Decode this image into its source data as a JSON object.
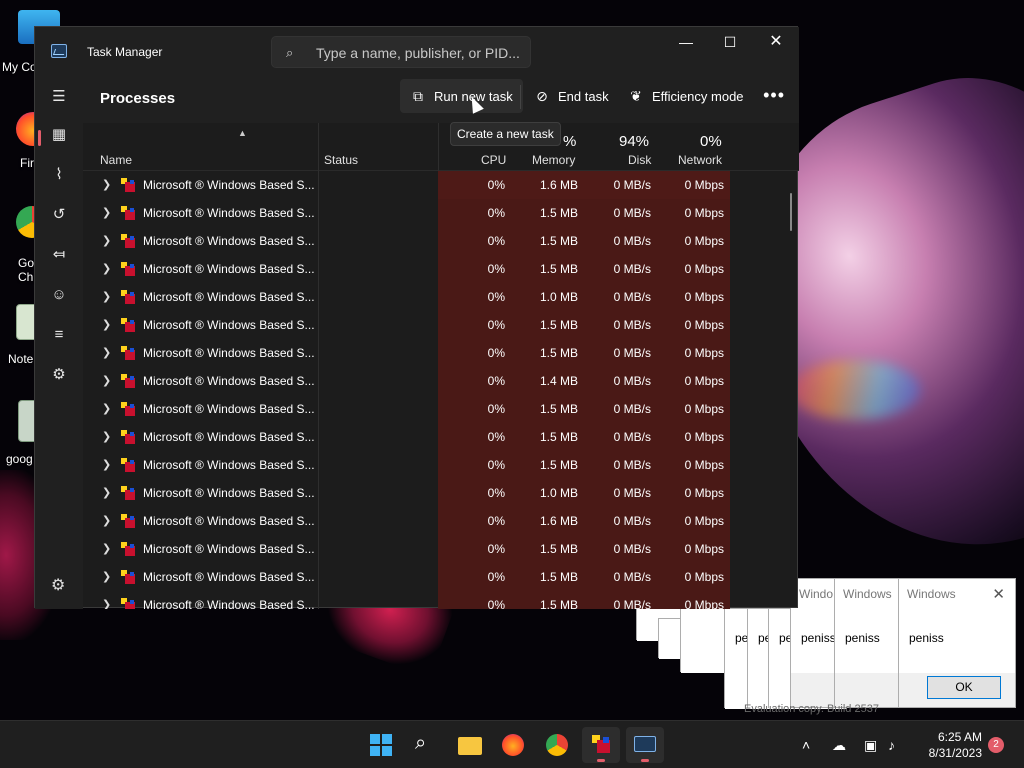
{
  "desktop": {
    "icons": [
      {
        "label": "My Co"
      },
      {
        "label": "Fir"
      },
      {
        "label": "Go\nChr"
      },
      {
        "label": "Note"
      },
      {
        "label": "goog"
      }
    ],
    "watermark": "Evaluation copy. Build 2537"
  },
  "task_manager": {
    "title": "Task Manager",
    "search_placeholder": "Type a name, publisher, or PID...",
    "heading": "Processes",
    "toolbar": {
      "run_new_task": "Run new task",
      "end_task": "End task",
      "efficiency_mode": "Efficiency mode",
      "more": "•••"
    },
    "tooltip": "Create a new task",
    "columns": {
      "name": "Name",
      "status": "Status",
      "cpu_pct": "%",
      "cpu": "CPU",
      "memory": "Memory",
      "disk_pct": "94%",
      "disk": "Disk",
      "network_pct": "0%",
      "network": "Network"
    },
    "rows": [
      {
        "name": "Microsoft ® Windows Based S...",
        "cpu": "0%",
        "memory": "1.6 MB",
        "disk": "0 MB/s",
        "network": "0 Mbps"
      },
      {
        "name": "Microsoft ® Windows Based S...",
        "cpu": "0%",
        "memory": "1.5 MB",
        "disk": "0 MB/s",
        "network": "0 Mbps"
      },
      {
        "name": "Microsoft ® Windows Based S...",
        "cpu": "0%",
        "memory": "1.5 MB",
        "disk": "0 MB/s",
        "network": "0 Mbps"
      },
      {
        "name": "Microsoft ® Windows Based S...",
        "cpu": "0%",
        "memory": "1.5 MB",
        "disk": "0 MB/s",
        "network": "0 Mbps"
      },
      {
        "name": "Microsoft ® Windows Based S...",
        "cpu": "0%",
        "memory": "1.0 MB",
        "disk": "0 MB/s",
        "network": "0 Mbps"
      },
      {
        "name": "Microsoft ® Windows Based S...",
        "cpu": "0%",
        "memory": "1.5 MB",
        "disk": "0 MB/s",
        "network": "0 Mbps"
      },
      {
        "name": "Microsoft ® Windows Based S...",
        "cpu": "0%",
        "memory": "1.5 MB",
        "disk": "0 MB/s",
        "network": "0 Mbps"
      },
      {
        "name": "Microsoft ® Windows Based S...",
        "cpu": "0%",
        "memory": "1.4 MB",
        "disk": "0 MB/s",
        "network": "0 Mbps"
      },
      {
        "name": "Microsoft ® Windows Based S...",
        "cpu": "0%",
        "memory": "1.5 MB",
        "disk": "0 MB/s",
        "network": "0 Mbps"
      },
      {
        "name": "Microsoft ® Windows Based S...",
        "cpu": "0%",
        "memory": "1.5 MB",
        "disk": "0 MB/s",
        "network": "0 Mbps"
      },
      {
        "name": "Microsoft ® Windows Based S...",
        "cpu": "0%",
        "memory": "1.5 MB",
        "disk": "0 MB/s",
        "network": "0 Mbps"
      },
      {
        "name": "Microsoft ® Windows Based S...",
        "cpu": "0%",
        "memory": "1.0 MB",
        "disk": "0 MB/s",
        "network": "0 Mbps"
      },
      {
        "name": "Microsoft ® Windows Based S...",
        "cpu": "0%",
        "memory": "1.6 MB",
        "disk": "0 MB/s",
        "network": "0 Mbps"
      },
      {
        "name": "Microsoft ® Windows Based S...",
        "cpu": "0%",
        "memory": "1.5 MB",
        "disk": "0 MB/s",
        "network": "0 Mbps"
      },
      {
        "name": "Microsoft ® Windows Based S...",
        "cpu": "0%",
        "memory": "1.5 MB",
        "disk": "0 MB/s",
        "network": "0 Mbps"
      },
      {
        "name": "Microsoft ® Windows Based S...",
        "cpu": "0%",
        "memory": "1.5 MB",
        "disk": "0 MB/s",
        "network": "0 Mbps"
      }
    ]
  },
  "message_boxes": {
    "title_short": "Windo",
    "title": "Windows",
    "text": "peniss",
    "text_short": "pe",
    "ok": "OK",
    "close": "✕"
  },
  "taskbar": {
    "time": "6:25 AM",
    "date": "8/31/2023",
    "notifications": "2"
  }
}
